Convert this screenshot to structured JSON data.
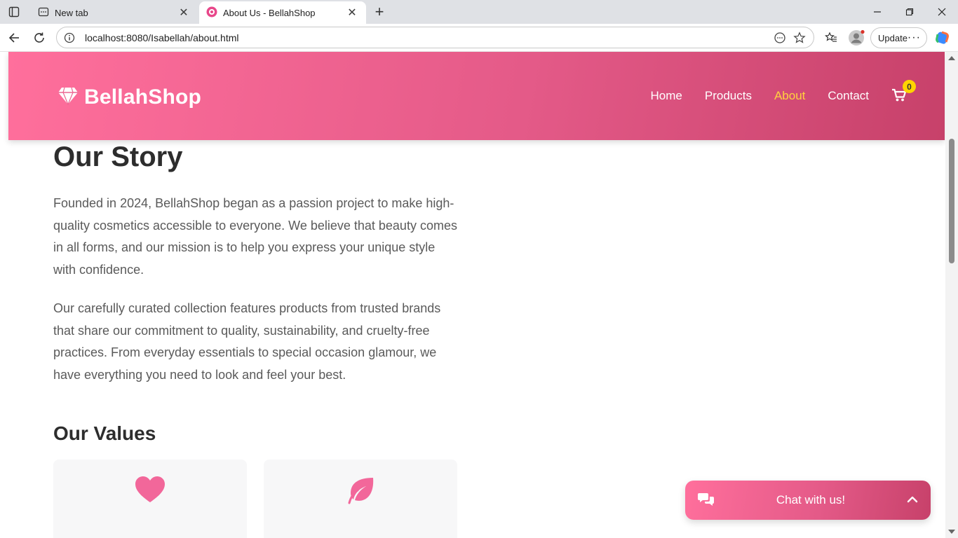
{
  "browser": {
    "tabs": [
      {
        "title": "New tab"
      },
      {
        "title": "About Us - BellahShop"
      }
    ],
    "url": "localhost:8080/Isabellah/about.html",
    "update_label": "Update"
  },
  "site": {
    "brand": "BellahShop",
    "nav": [
      {
        "label": "Home"
      },
      {
        "label": "Products"
      },
      {
        "label": "About"
      },
      {
        "label": "Contact"
      }
    ],
    "cart_count": "0",
    "colors": {
      "accent": "#e45a88",
      "active_nav": "#ffd23f",
      "badge": "#ffd400"
    }
  },
  "story": {
    "heading": "Our Story",
    "p1": "Founded in 2024, BellahShop began as a passion project to make high-quality cosmetics accessible to everyone. We believe that beauty comes in all forms, and our mission is to help you express your unique style with confidence.",
    "p2": "Our carefully curated collection features products from trusted brands that share our commitment to quality, sustainability, and cruelty-free practices. From everyday essentials to special occasion glamour, we have everything you need to look and feel your best."
  },
  "values": {
    "heading": "Our Values",
    "cards": [
      {
        "icon": "heart-icon"
      },
      {
        "icon": "leaf-icon"
      }
    ]
  },
  "chat": {
    "label": "Chat with us!"
  }
}
